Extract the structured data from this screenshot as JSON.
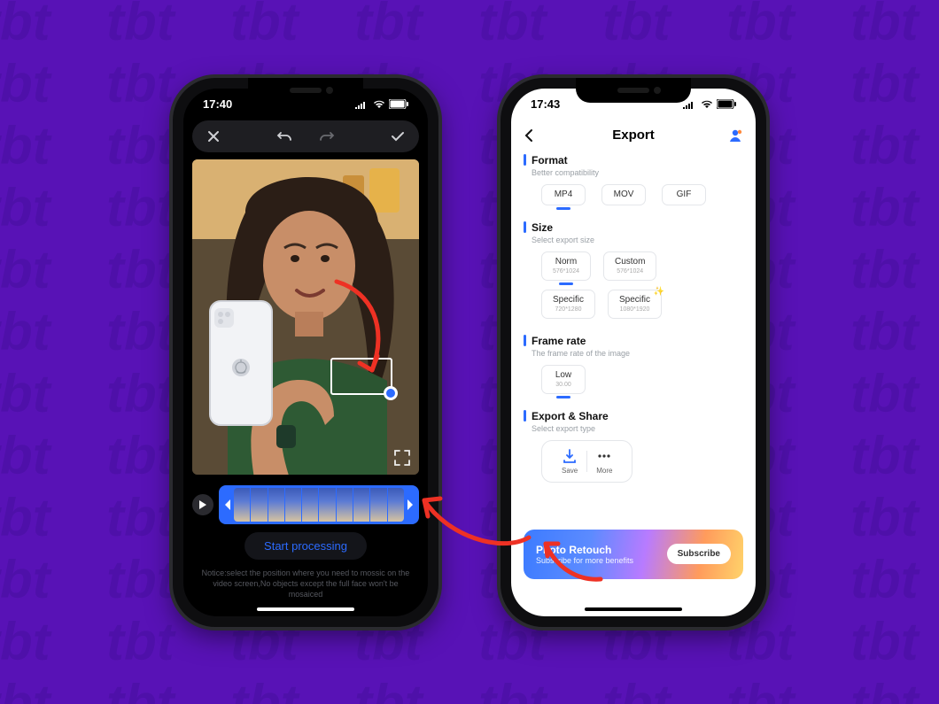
{
  "left": {
    "status_time": "17:40",
    "toolbar": {
      "close": "close",
      "undo": "undo",
      "redo": "redo",
      "confirm": "confirm"
    },
    "start_label": "Start processing",
    "notice": "Notice:select the position where you need to mossic on the video screen,No objects except the full face won't be mosaiced"
  },
  "right": {
    "status_time": "17:43",
    "nav_title": "Export",
    "sections": {
      "format": {
        "title": "Format",
        "sub": "Better compatibility",
        "opts": [
          {
            "lbl": "MP4"
          },
          {
            "lbl": "MOV"
          },
          {
            "lbl": "GIF"
          }
        ],
        "selected": 0
      },
      "size": {
        "title": "Size",
        "sub": "Select export size",
        "opts": [
          {
            "lbl": "Norm",
            "sub": "576*1024"
          },
          {
            "lbl": "Custom",
            "sub": "576*1024"
          },
          {
            "lbl": "Specific",
            "sub": "720*1280"
          },
          {
            "lbl": "Specific",
            "sub": "1080*1920",
            "sparkle": true
          }
        ],
        "selected": 0
      },
      "framerate": {
        "title": "Frame rate",
        "sub": "The frame rate of the image",
        "opts": [
          {
            "lbl": "Low",
            "sub": "30.00"
          }
        ],
        "selected": 0
      },
      "export": {
        "title": "Export & Share",
        "sub": "Select export type",
        "items": [
          {
            "lbl": "Save",
            "kind": "save"
          },
          {
            "lbl": "More",
            "kind": "more"
          }
        ]
      }
    },
    "promo": {
      "title": "Photo Retouch",
      "sub": "Subscribe for more benefits",
      "cta": "Subscribe"
    }
  }
}
